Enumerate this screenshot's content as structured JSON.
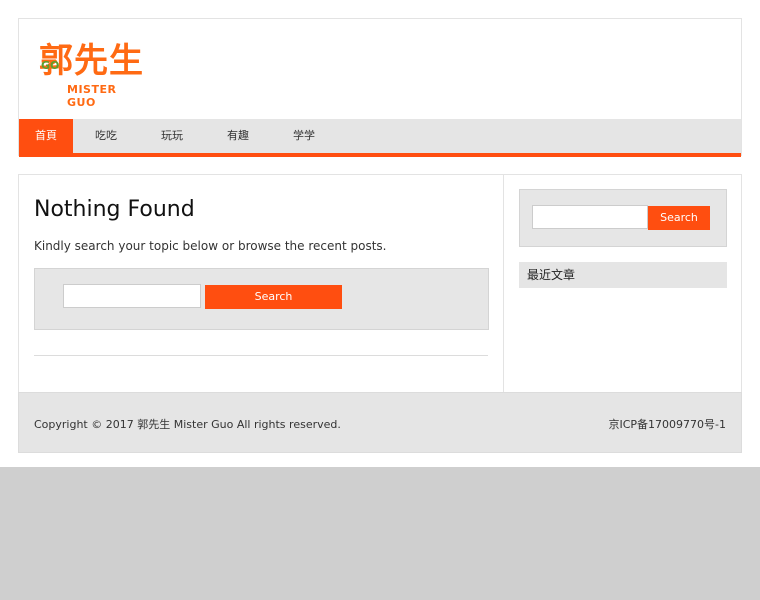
{
  "logo": {
    "chinese": "郭先生",
    "english": "MISTER GUO",
    "badge": "GO"
  },
  "nav": {
    "items": [
      {
        "label": "首頁"
      },
      {
        "label": "吃吃"
      },
      {
        "label": "玩玩"
      },
      {
        "label": "有趣"
      },
      {
        "label": "学学"
      }
    ]
  },
  "main": {
    "title": "Nothing Found",
    "message": "Kindly search your topic below or browse the recent posts.",
    "search_button": "Search"
  },
  "sidebar": {
    "search_button": "Search",
    "recent_title": "最近文章"
  },
  "footer": {
    "copyright": "Copyright © 2017 郭先生 Mister Guo All rights reserved.",
    "icp": "京ICP备17009770号-1"
  },
  "colors": {
    "accent": "#ff4e10",
    "logo": "#ff6a13",
    "background": "#cfcfcf"
  }
}
